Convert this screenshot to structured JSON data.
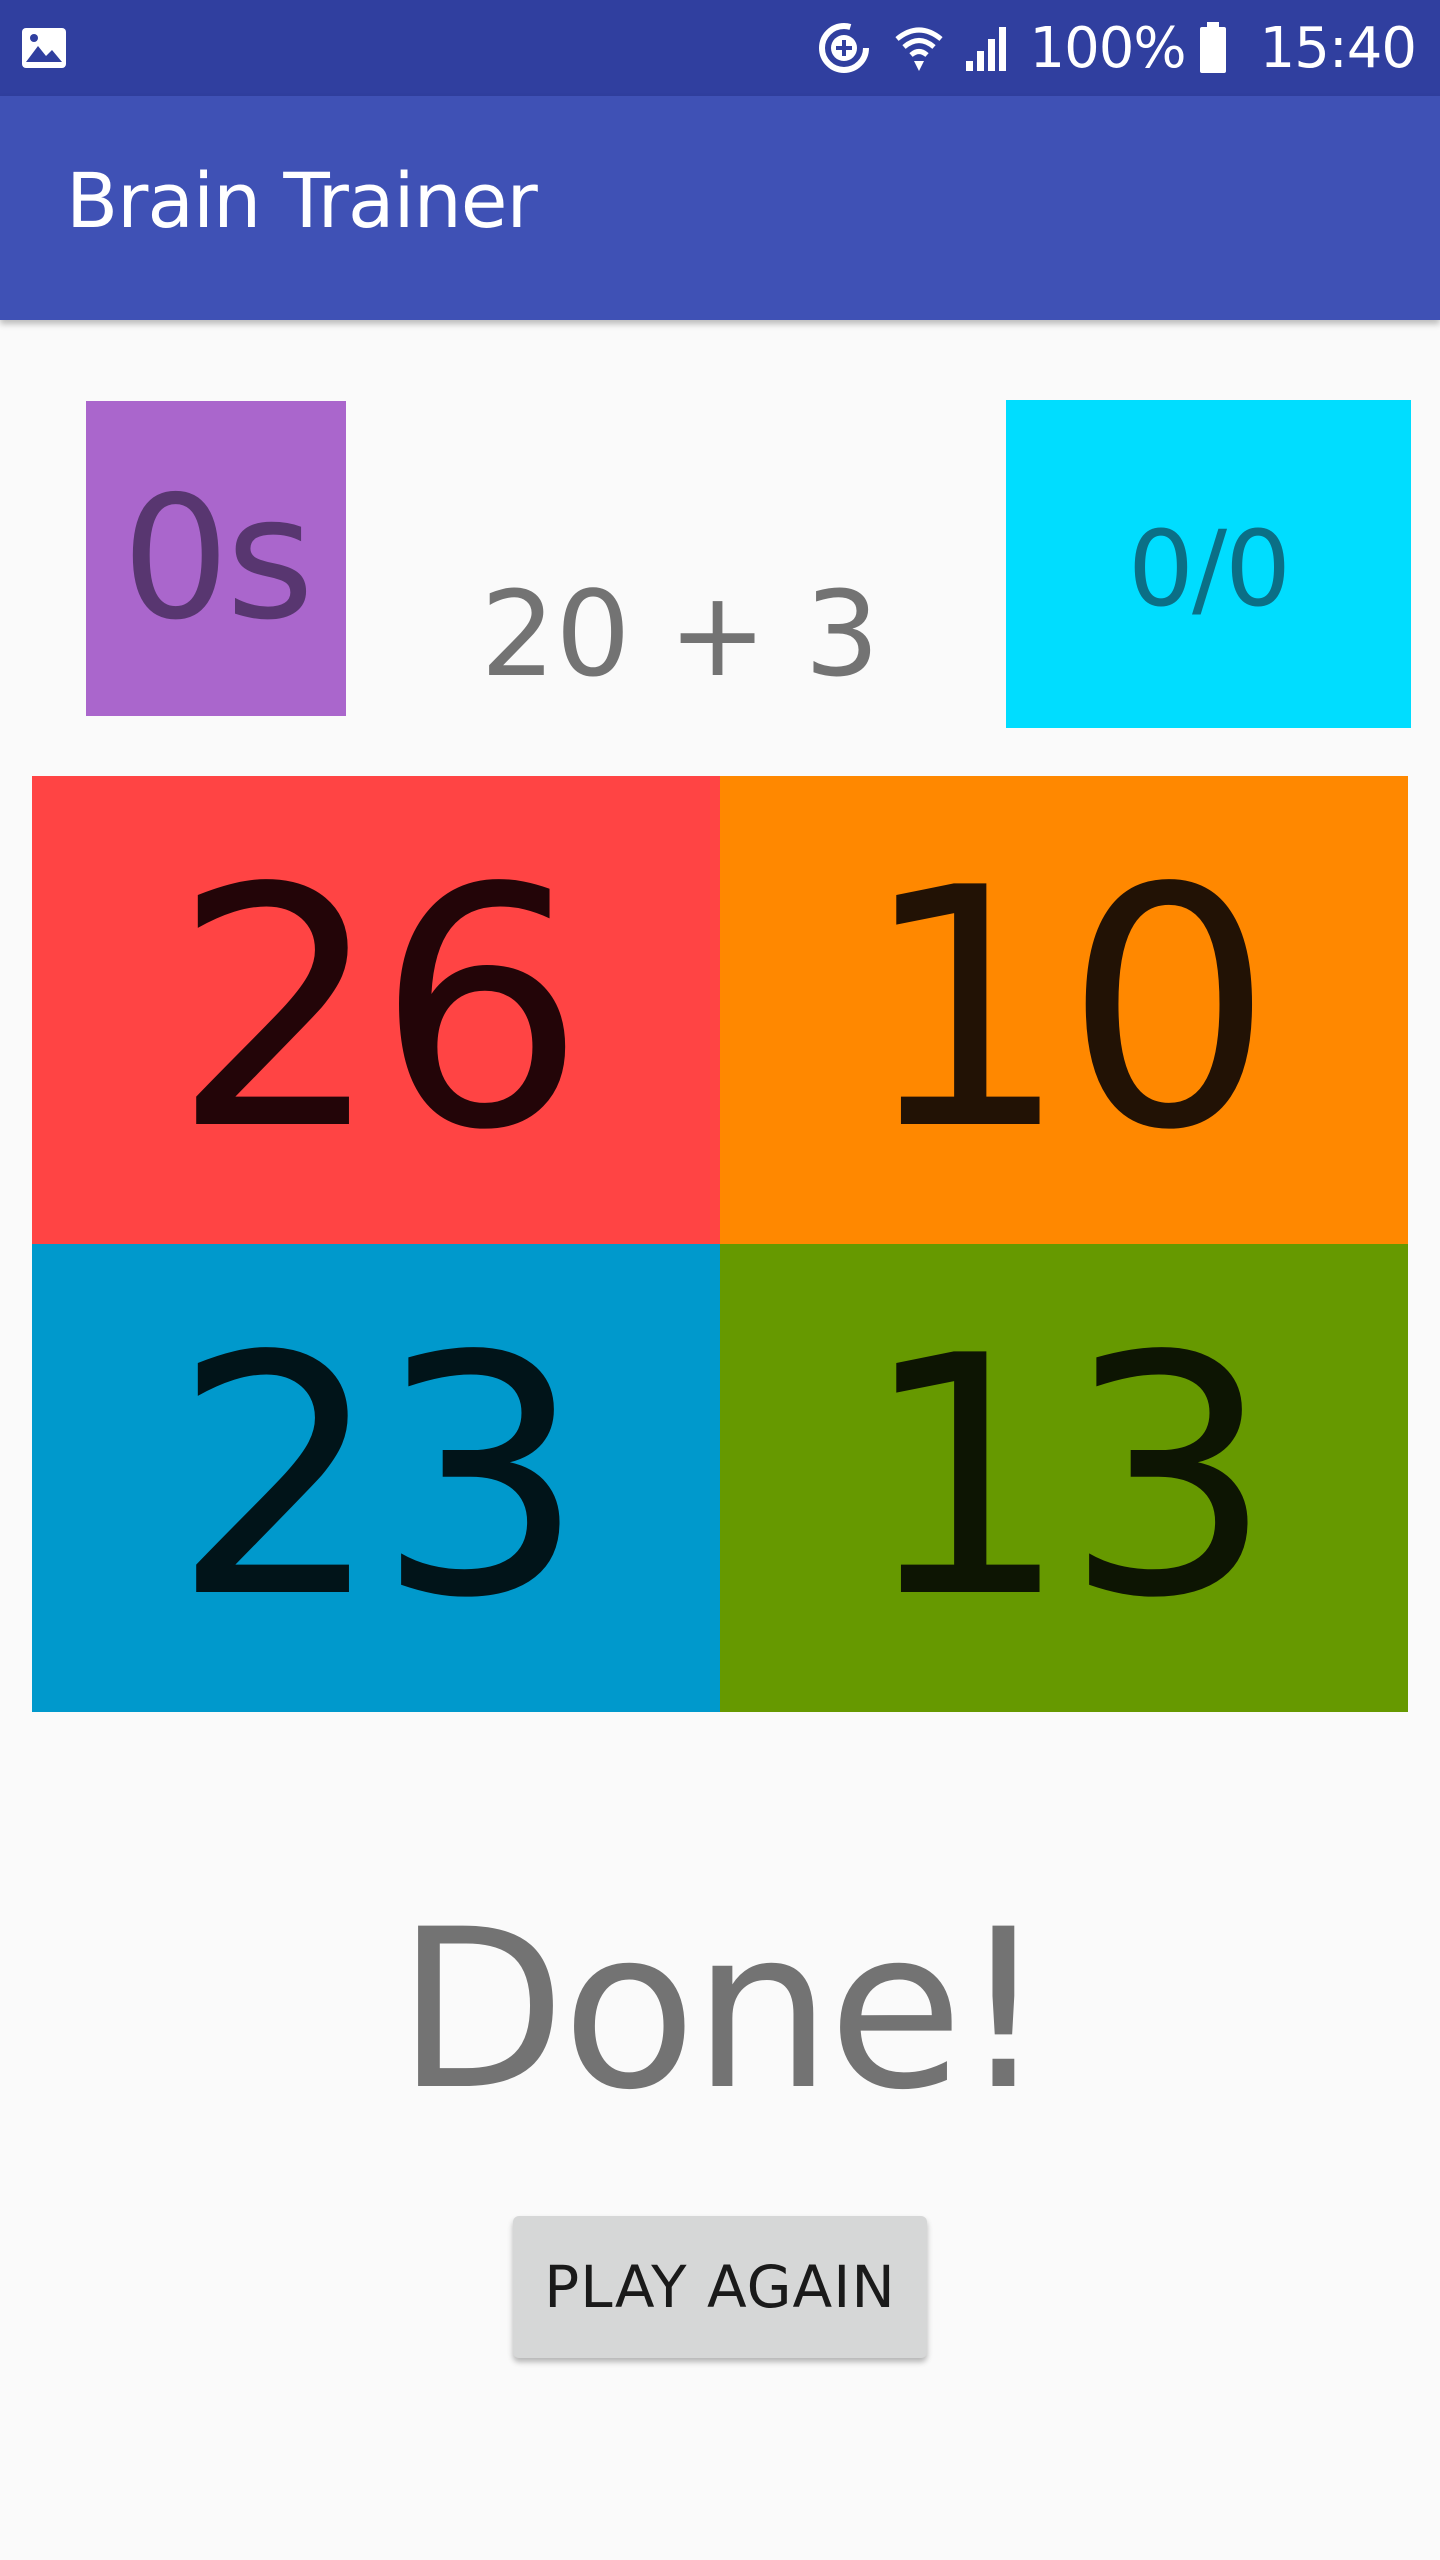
{
  "status_bar": {
    "battery_percent": "100%",
    "time": "15:40",
    "icons": [
      "gallery-icon",
      "sync-add-icon",
      "wifi-icon",
      "signal-icon",
      "battery-icon"
    ]
  },
  "app_bar": {
    "title": "Brain Trainer",
    "color": "#3f51b5"
  },
  "game": {
    "timer": "0s",
    "question": "20 + 3",
    "score": "0/0",
    "answers": [
      {
        "label": "26",
        "color": "#ff4444"
      },
      {
        "label": "10",
        "color": "#ff8800"
      },
      {
        "label": "23",
        "color": "#0099cc"
      },
      {
        "label": "13",
        "color": "#669900"
      }
    ],
    "result": "Done!",
    "play_again_label": "PLAY AGAIN"
  }
}
